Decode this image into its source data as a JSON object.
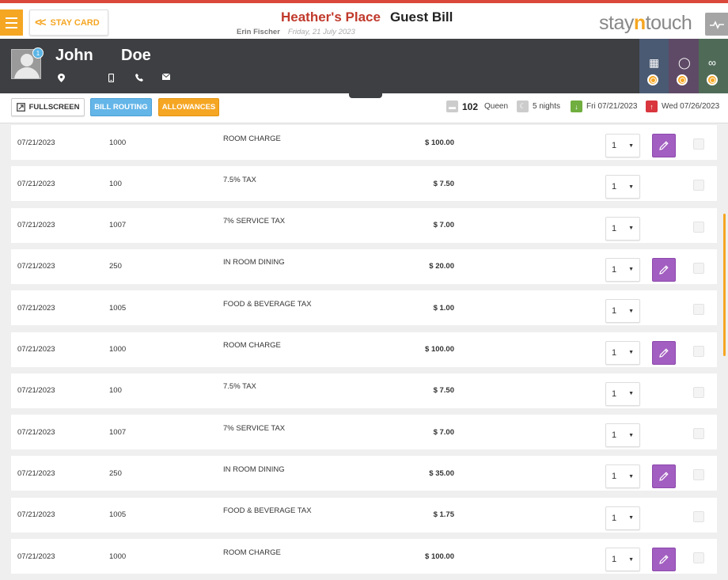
{
  "header": {
    "stay_card_label": "STAY CARD",
    "hotel_name": "Heather's Place",
    "page_title": "Guest Bill",
    "user_name": "Erin Fischer",
    "business_date": "Friday, 21 July 2023",
    "logo_text_1": "stay",
    "logo_text_2": "n",
    "logo_text_3": "touch"
  },
  "guest": {
    "first_name": "John",
    "last_name": "Doe",
    "badge_count": "1"
  },
  "toolbar": {
    "fullscreen_label": "FULLSCREEN",
    "bill_routing_label": "BILL ROUTING",
    "allowances_label": "ALLOWANCES",
    "room_number": "102",
    "room_type": "Queen",
    "nights": "5 nights",
    "arrival": "Fri 07/21/2023",
    "departure": "Wed 07/26/2023"
  },
  "colors": {
    "accent": "#f5a623",
    "brand_red": "#c0392b",
    "edit_purple": "#a25ec0",
    "bill_routing_blue": "#64b5e8",
    "header_band": "#3d3f42"
  },
  "charges": [
    {
      "date": "07/21/2023",
      "code": "1000",
      "description": "ROOM CHARGE",
      "amount": "$ 100.00",
      "qty": "1",
      "editable": true
    },
    {
      "date": "07/21/2023",
      "code": "100",
      "description": "7.5% TAX",
      "amount": "$ 7.50",
      "qty": "1",
      "editable": false
    },
    {
      "date": "07/21/2023",
      "code": "1007",
      "description": "7% SERVICE TAX",
      "amount": "$ 7.00",
      "qty": "1",
      "editable": false
    },
    {
      "date": "07/21/2023",
      "code": "250",
      "description": "IN ROOM DINING",
      "amount": "$ 20.00",
      "qty": "1",
      "editable": true
    },
    {
      "date": "07/21/2023",
      "code": "1005",
      "description": "FOOD & BEVERAGE TAX",
      "amount": "$ 1.00",
      "qty": "1",
      "editable": false
    },
    {
      "date": "07/21/2023",
      "code": "1000",
      "description": "ROOM CHARGE",
      "amount": "$ 100.00",
      "qty": "1",
      "editable": true
    },
    {
      "date": "07/21/2023",
      "code": "100",
      "description": "7.5% TAX",
      "amount": "$ 7.50",
      "qty": "1",
      "editable": false
    },
    {
      "date": "07/21/2023",
      "code": "1007",
      "description": "7% SERVICE TAX",
      "amount": "$ 7.00",
      "qty": "1",
      "editable": false
    },
    {
      "date": "07/21/2023",
      "code": "250",
      "description": "IN ROOM DINING",
      "amount": "$ 35.00",
      "qty": "1",
      "editable": true
    },
    {
      "date": "07/21/2023",
      "code": "1005",
      "description": "FOOD & BEVERAGE TAX",
      "amount": "$ 1.75",
      "qty": "1",
      "editable": false
    },
    {
      "date": "07/21/2023",
      "code": "1000",
      "description": "ROOM CHARGE",
      "amount": "$ 100.00",
      "qty": "1",
      "editable": true
    }
  ]
}
